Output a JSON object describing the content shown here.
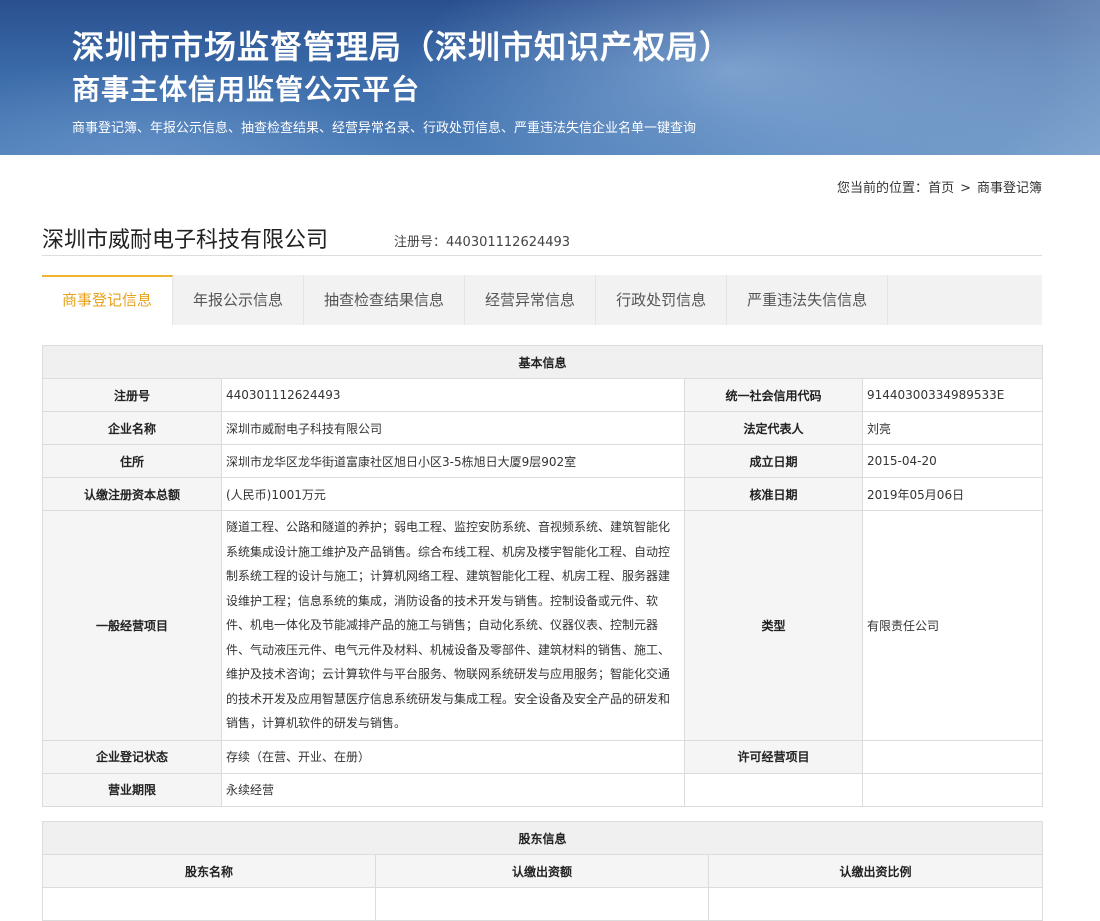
{
  "header": {
    "title_line1": "深圳市市场监督管理局（深圳市知识产权局）",
    "title_line2": "商事主体信用监管公示平台",
    "subtitle": "商事登记簿、年报公示信息、抽查检查结果、经营异常名录、行政处罚信息、严重违法失信企业名单一键查询"
  },
  "breadcrumb": {
    "prefix": "您当前的位置：",
    "home": "首页",
    "separator": ">",
    "current": "商事登记簿"
  },
  "company": {
    "name": "深圳市威耐电子科技有限公司",
    "reg_label": "注册号：",
    "reg_no": "440301112624493"
  },
  "tabs": [
    {
      "label": "商事登记信息",
      "active": true
    },
    {
      "label": "年报公示信息",
      "active": false
    },
    {
      "label": "抽查检查结果信息",
      "active": false
    },
    {
      "label": "经营异常信息",
      "active": false
    },
    {
      "label": "行政处罚信息",
      "active": false
    },
    {
      "label": "严重违法失信信息",
      "active": false
    }
  ],
  "basic_info": {
    "caption": "基本信息",
    "reg_no_label": "注册号",
    "reg_no": "440301112624493",
    "credit_code_label": "统一社会信用代码",
    "credit_code": "91440300334989533E",
    "name_label": "企业名称",
    "name": "深圳市威耐电子科技有限公司",
    "legal_rep_label": "法定代表人",
    "legal_rep": "刘亮",
    "address_label": "住所",
    "address": "深圳市龙华区龙华街道富康社区旭日小区3-5栋旭日大厦9层902室",
    "founded_label": "成立日期",
    "founded": "2015-04-20",
    "capital_label": "认缴注册资本总额",
    "capital": "(人民币)1001万元",
    "approved_label": "核准日期",
    "approved": "2019年05月06日",
    "scope_label": "一般经营项目",
    "scope": "隧道工程、公路和隧道的养护；弱电工程、监控安防系统、音视频系统、建筑智能化系统集成设计施工维护及产品销售。综合布线工程、机房及楼宇智能化工程、自动控制系统工程的设计与施工；计算机网络工程、建筑智能化工程、机房工程、服务器建设维护工程；信息系统的集成，消防设备的技术开发与销售。控制设备或元件、软件、机电一体化及节能减排产品的施工与销售；自动化系统、仪器仪表、控制元器件、气动液压元件、电气元件及材料、机械设备及零部件、建筑材料的销售、施工、维护及技术咨询；云计算软件与平台服务、物联网系统研发与应用服务；智能化交通的技术开发及应用智慧医疗信息系统研发与集成工程。安全设备及安全产品的研发和销售，计算机软件的研发与销售。",
    "type_label": "类型",
    "type": "有限责任公司",
    "status_label": "企业登记状态",
    "status": "存续（在营、开业、在册）",
    "license_label": "许可经营项目",
    "license": "",
    "term_label": "营业期限",
    "term": "永续经营"
  },
  "shareholders": {
    "caption": "股东信息",
    "columns": [
      "股东名称",
      "认缴出资额",
      "认缴出资比例"
    ]
  }
}
